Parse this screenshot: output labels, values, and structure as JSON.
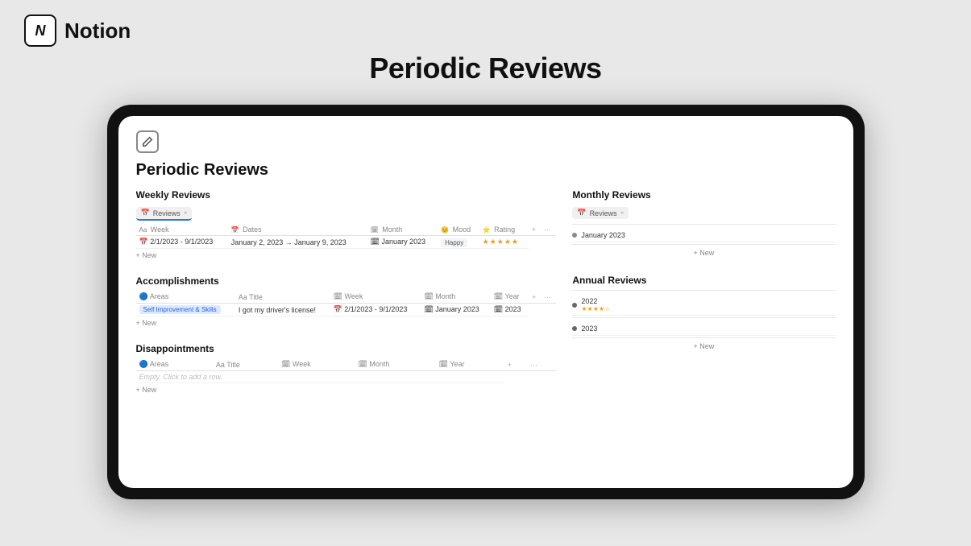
{
  "header": {
    "brand": "Notion",
    "logo_letter": "N",
    "page_title": "Periodic Reviews"
  },
  "notion_page": {
    "icon": "✏️",
    "title": "Periodic Reviews",
    "weekly_reviews": {
      "section_title": "Weekly Reviews",
      "view_tab": "Reviews",
      "columns": [
        "Aa Week",
        "📅 Dates",
        "🗓 Month",
        "😊 Mood",
        "⭐ Rating"
      ],
      "rows": [
        {
          "week": "2/1/2023 - 9/1/2023",
          "dates": "January 2, 2023 → January 9, 2023",
          "month": "January 2023",
          "mood": "Happy",
          "rating": "★★★★★"
        }
      ],
      "new_row": "New"
    },
    "accomplishments": {
      "section_title": "Accomplishments",
      "columns": [
        "🔵 Areas",
        "Aa Title",
        "🗓 Week",
        "🗓 Month",
        "🗓 Year"
      ],
      "rows": [
        {
          "area": "Self Improvement & Skills",
          "title": "I got my driver's license!",
          "week": "2/1/2023 - 9/1/2023",
          "month": "January 2023",
          "year": "2023"
        }
      ],
      "new_row": "New"
    },
    "disappointments": {
      "section_title": "Disappointments",
      "columns": [
        "🔵 Areas",
        "Aa Title",
        "🗓 Week",
        "🗓 Month",
        "🗓 Year"
      ],
      "rows": [],
      "empty_text": "Empty. Click to add a row.",
      "new_row": "New"
    },
    "monthly_reviews": {
      "section_title": "Monthly Reviews",
      "view_tab": "Reviews",
      "items": [
        {
          "label": "January 2023",
          "stars": ""
        }
      ],
      "new_row": "+ New"
    },
    "annual_reviews": {
      "section_title": "Annual Reviews",
      "items": [
        {
          "label": "2022",
          "stars": "★★★★☆"
        },
        {
          "label": "2023",
          "stars": ""
        }
      ],
      "new_row": "+ New"
    }
  },
  "icons": {
    "edit": "✎",
    "calendar": "📅",
    "calendar2": "🗓",
    "smiley": "😊",
    "star": "⭐",
    "circle": "🔵",
    "bullet": "•"
  }
}
